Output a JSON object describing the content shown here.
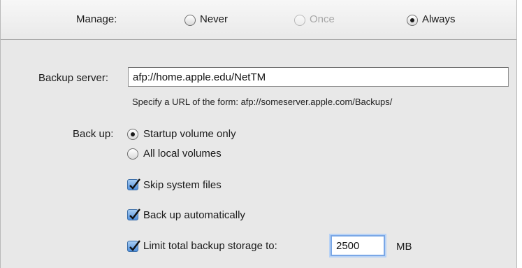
{
  "manage": {
    "label": "Manage:",
    "options": [
      {
        "label": "Never",
        "state": "unselected"
      },
      {
        "label": "Once",
        "state": "disabled"
      },
      {
        "label": "Always",
        "state": "selected"
      }
    ]
  },
  "backup_server": {
    "label": "Backup server:",
    "value": "afp://home.apple.edu/NetTM",
    "hint": "Specify a URL of the form: afp://someserver.apple.com/Backups/"
  },
  "back_up": {
    "label": "Back up:",
    "options": [
      {
        "label": "Startup volume only",
        "selected": true
      },
      {
        "label": "All local volumes",
        "selected": false
      }
    ]
  },
  "checkboxes": [
    {
      "label": "Skip system files",
      "checked": true
    },
    {
      "label": "Back up automatically",
      "checked": true
    },
    {
      "label": "Limit total backup storage to:",
      "checked": true
    }
  ],
  "storage_limit": {
    "value": "2500",
    "unit": "MB"
  },
  "colors": {
    "panel_bg": "#e8e8e8",
    "checkbox_blue": "#4f8fdc",
    "focus_ring": "#7aa7e6"
  }
}
